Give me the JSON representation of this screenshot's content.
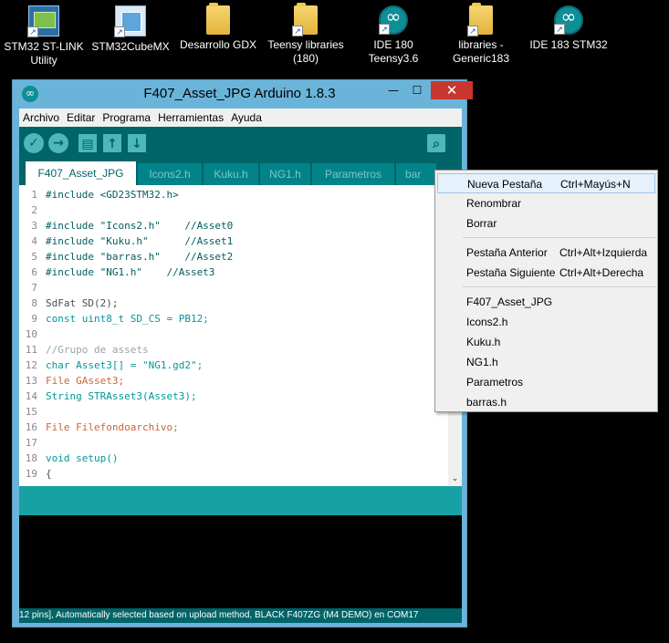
{
  "desktop": {
    "icons": [
      {
        "label": "STM32 ST-LINK Utility",
        "icon": "stlink-icon"
      },
      {
        "label": "STM32CubeMX",
        "icon": "cube-icon"
      },
      {
        "label": "Desarrollo GDX",
        "icon": "folder-icon"
      },
      {
        "label": "Teensy libraries (180)",
        "icon": "folder-icon"
      },
      {
        "label": "IDE 180 Teensy3.6",
        "icon": "arduino-icon"
      },
      {
        "label": "libraries - Generic183",
        "icon": "folder-icon"
      },
      {
        "label": "IDE 183 STM32",
        "icon": "arduino-icon"
      }
    ]
  },
  "window": {
    "title": "F407_Asset_JPG Arduino 1.8.3",
    "min": "—",
    "max": "☐",
    "close": "✕"
  },
  "menubar": [
    "Archivo",
    "Editar",
    "Programa",
    "Herramientas",
    "Ayuda"
  ],
  "toolbar": {
    "verify": "✓",
    "upload": "→",
    "new": "▤",
    "open": "↑",
    "save": "↓",
    "serial": "⌕"
  },
  "tabs": [
    "F407_Asset_JPG",
    "Icons2.h",
    "Kuku.h",
    "NG1.h",
    "Parametros",
    "bar"
  ],
  "editor": {
    "lines": [
      {
        "n": "1",
        "text": "#include <GD23STM32.h>"
      },
      {
        "n": "2",
        "text": ""
      },
      {
        "n": "3",
        "text": "#include \"Icons2.h\"    //Asset0"
      },
      {
        "n": "4",
        "text": "#include \"Kuku.h\"      //Asset1"
      },
      {
        "n": "5",
        "text": "#include \"barras.h\"    //Asset2"
      },
      {
        "n": "6",
        "text": "#include \"NG1.h\"    //Asset3"
      },
      {
        "n": "7",
        "text": ""
      },
      {
        "n": "8",
        "text": "SdFat SD(2);"
      },
      {
        "n": "9",
        "text": "const uint8_t SD_CS = PB12;"
      },
      {
        "n": "10",
        "text": ""
      },
      {
        "n": "11",
        "text": "//Grupo de assets"
      },
      {
        "n": "12",
        "text": "char Asset3[] = \"NG1.gd2\";"
      },
      {
        "n": "13",
        "text": "File GAsset3;"
      },
      {
        "n": "14",
        "text": "String STRAsset3(Asset3);"
      },
      {
        "n": "15",
        "text": ""
      },
      {
        "n": "16",
        "text": "File Filefondoarchivo;"
      },
      {
        "n": "17",
        "text": ""
      },
      {
        "n": "18",
        "text": "void setup()"
      },
      {
        "n": "19",
        "text": "{"
      }
    ]
  },
  "status": {
    "bottom": "12 pins], Automatically selected based on upload method, BLACK F407ZG (M4 DEMO) en COM17"
  },
  "context_menu": {
    "items": [
      {
        "label": "Nueva Pestaña",
        "shortcut": "Ctrl+Mayús+N"
      },
      {
        "label": "Renombrar",
        "shortcut": ""
      },
      {
        "label": "Borrar",
        "shortcut": ""
      },
      {
        "label": "Pestaña Anterior",
        "shortcut": "Ctrl+Alt+Izquierda"
      },
      {
        "label": "Pestaña Siguiente",
        "shortcut": "Ctrl+Alt+Derecha"
      },
      {
        "label": "F407_Asset_JPG",
        "shortcut": ""
      },
      {
        "label": "Icons2.h",
        "shortcut": ""
      },
      {
        "label": "Kuku.h",
        "shortcut": ""
      },
      {
        "label": "NG1.h",
        "shortcut": ""
      },
      {
        "label": "Parametros",
        "shortcut": ""
      },
      {
        "label": "barras.h",
        "shortcut": ""
      }
    ]
  },
  "colors": {
    "arduino_teal": "#006468",
    "arduino_status": "#17a1a5",
    "window_frame": "#6ab4d9",
    "close_red": "#c7372f"
  }
}
